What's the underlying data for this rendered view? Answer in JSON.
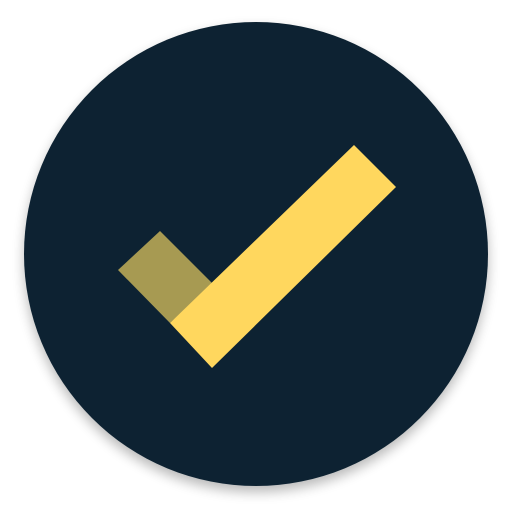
{
  "icon": {
    "name": "checkmark-app-icon",
    "colors": {
      "background_circle": "#0C2230",
      "check_short_arm": "#A79A52",
      "check_long_arm": "#FFD75E",
      "shadow": "#000000"
    }
  }
}
